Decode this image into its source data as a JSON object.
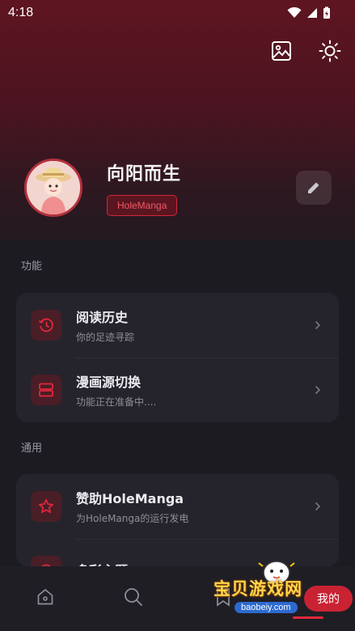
{
  "status": {
    "time": "4:18"
  },
  "profile": {
    "username": "向阳而生",
    "tag": "HoleManga"
  },
  "sections": {
    "features_title": "功能",
    "general_title": "通用"
  },
  "features": [
    {
      "title": "阅读历史",
      "subtitle": "你的足迹寻踪",
      "icon": "history-icon"
    },
    {
      "title": "漫画源切换",
      "subtitle": "功能正在准备中....",
      "icon": "source-switch-icon"
    }
  ],
  "general": [
    {
      "title": "赞助HoleManga",
      "subtitle": "为HoleManga的运行发电",
      "icon": "star-icon"
    },
    {
      "title": "多彩主题",
      "subtitle": "",
      "icon": "palette-icon"
    }
  ],
  "nav": {
    "mine_label": "我的"
  },
  "watermark": {
    "text": "宝贝游戏网",
    "url": "baobeiy.com"
  },
  "colors": {
    "accent": "#e3283b",
    "header": "#5e1521",
    "background": "#1c1b22",
    "card": "#25242c"
  }
}
